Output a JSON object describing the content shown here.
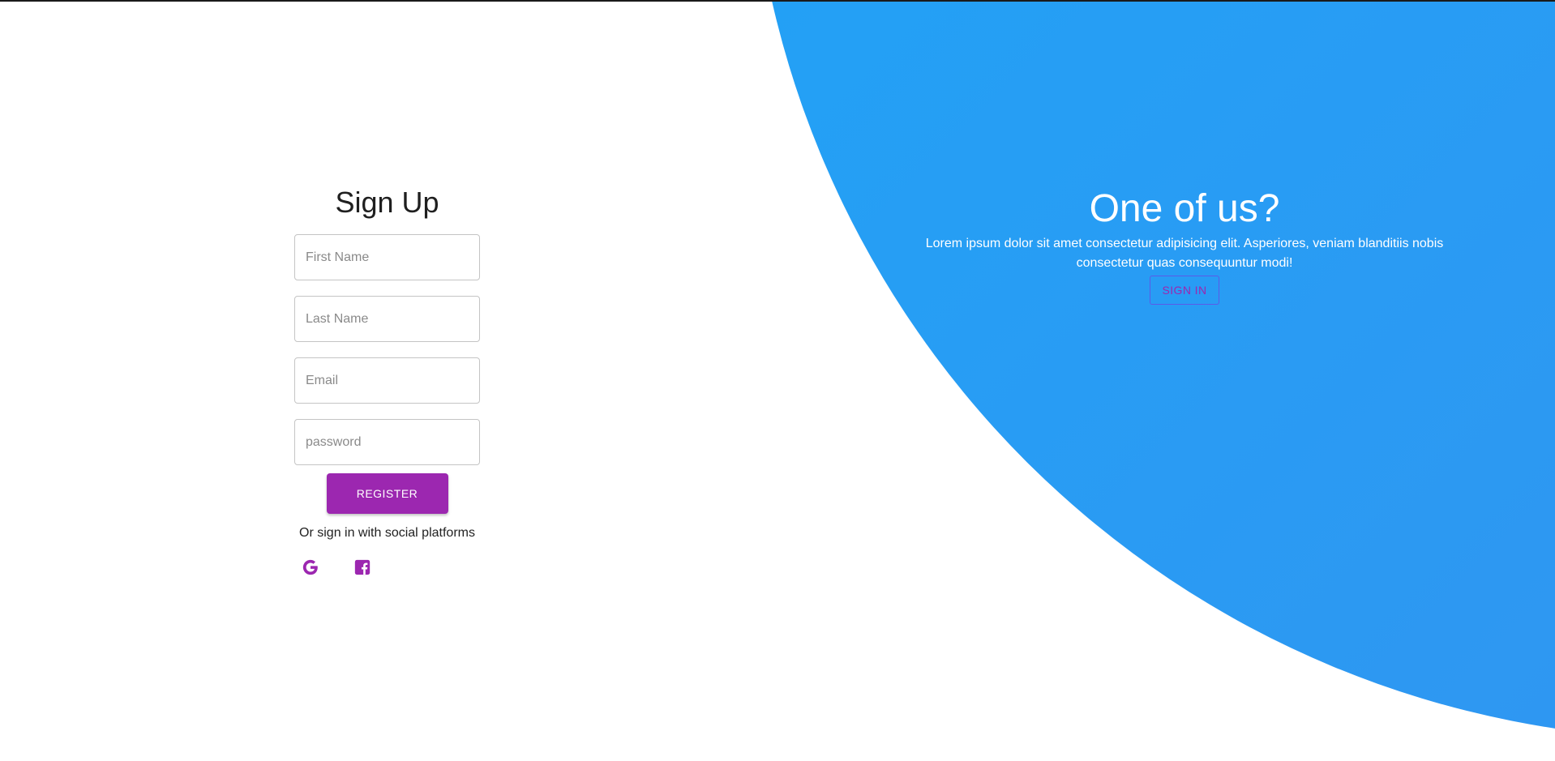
{
  "signup": {
    "title": "Sign Up",
    "first_name_placeholder": "First Name",
    "last_name_placeholder": "Last Name",
    "email_placeholder": "Email",
    "password_placeholder": "password",
    "register_label": "REGISTER",
    "social_text": "Or sign in with social platforms",
    "social_icons": [
      "google-icon",
      "facebook-icon"
    ]
  },
  "panel": {
    "title": "One of us?",
    "text": "Lorem ipsum dolor sit amet consectetur adipisicing elit. Asperiores, veniam blanditiis nobis consectetur quas consequuntur modi!",
    "signin_label": "SIGN IN"
  },
  "colors": {
    "accent": "#9c27b0",
    "gradient_start": "#1aa8f8",
    "gradient_end": "#3790ef"
  }
}
